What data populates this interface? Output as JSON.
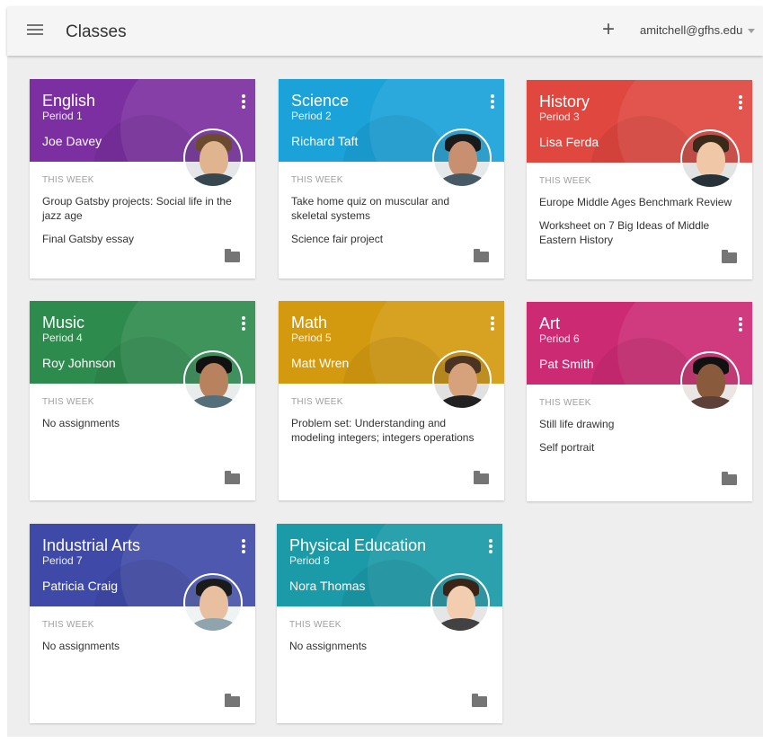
{
  "header": {
    "title": "Classes",
    "add_icon": "+",
    "account": "amitchell@gfhs.edu"
  },
  "week_label": "THIS WEEK",
  "classes": [
    {
      "title": "English",
      "period": "Period 1",
      "teacher": "Joe Davey",
      "color": "#7b2fa0",
      "assignments": [
        "Group Gatsby projects: Social life in the jazz age",
        "Final Gatsby essay"
      ]
    },
    {
      "title": "Science",
      "period": "Period 2",
      "teacher": "Richard Taft",
      "color": "#1ba2d9",
      "assignments": [
        "Take home quiz on muscular and skeletal systems",
        "Science fair project"
      ]
    },
    {
      "title": "History",
      "period": "Period 3",
      "teacher": "Lisa Ferda",
      "color": "#e0473f",
      "assignments": [
        "Europe Middle Ages Benchmark Review",
        "Worksheet on 7 Big Ideas of Middle Eastern History"
      ]
    },
    {
      "title": "Music",
      "period": "Period 4",
      "teacher": "Roy Johnson",
      "color": "#2e8b4e",
      "assignments": [
        "No assignments"
      ]
    },
    {
      "title": "Math",
      "period": "Period 5",
      "teacher": "Matt Wren",
      "color": "#d49a0f",
      "assignments": [
        "Problem set: Understanding and modeling integers; integers operations"
      ]
    },
    {
      "title": "Art",
      "period": "Period 6",
      "teacher": "Pat Smith",
      "color": "#cc2a73",
      "assignments": [
        "Still life drawing",
        "Self portrait"
      ]
    },
    {
      "title": "Industrial Arts",
      "period": "Period 7",
      "teacher": "Patricia Craig",
      "color": "#3f4aa8",
      "assignments": [
        "No assignments"
      ]
    },
    {
      "title": "Physical Education",
      "period": "Period 8",
      "teacher": "Nora Thomas",
      "color": "#1b9aa8",
      "assignments": [
        "No assignments"
      ]
    }
  ]
}
